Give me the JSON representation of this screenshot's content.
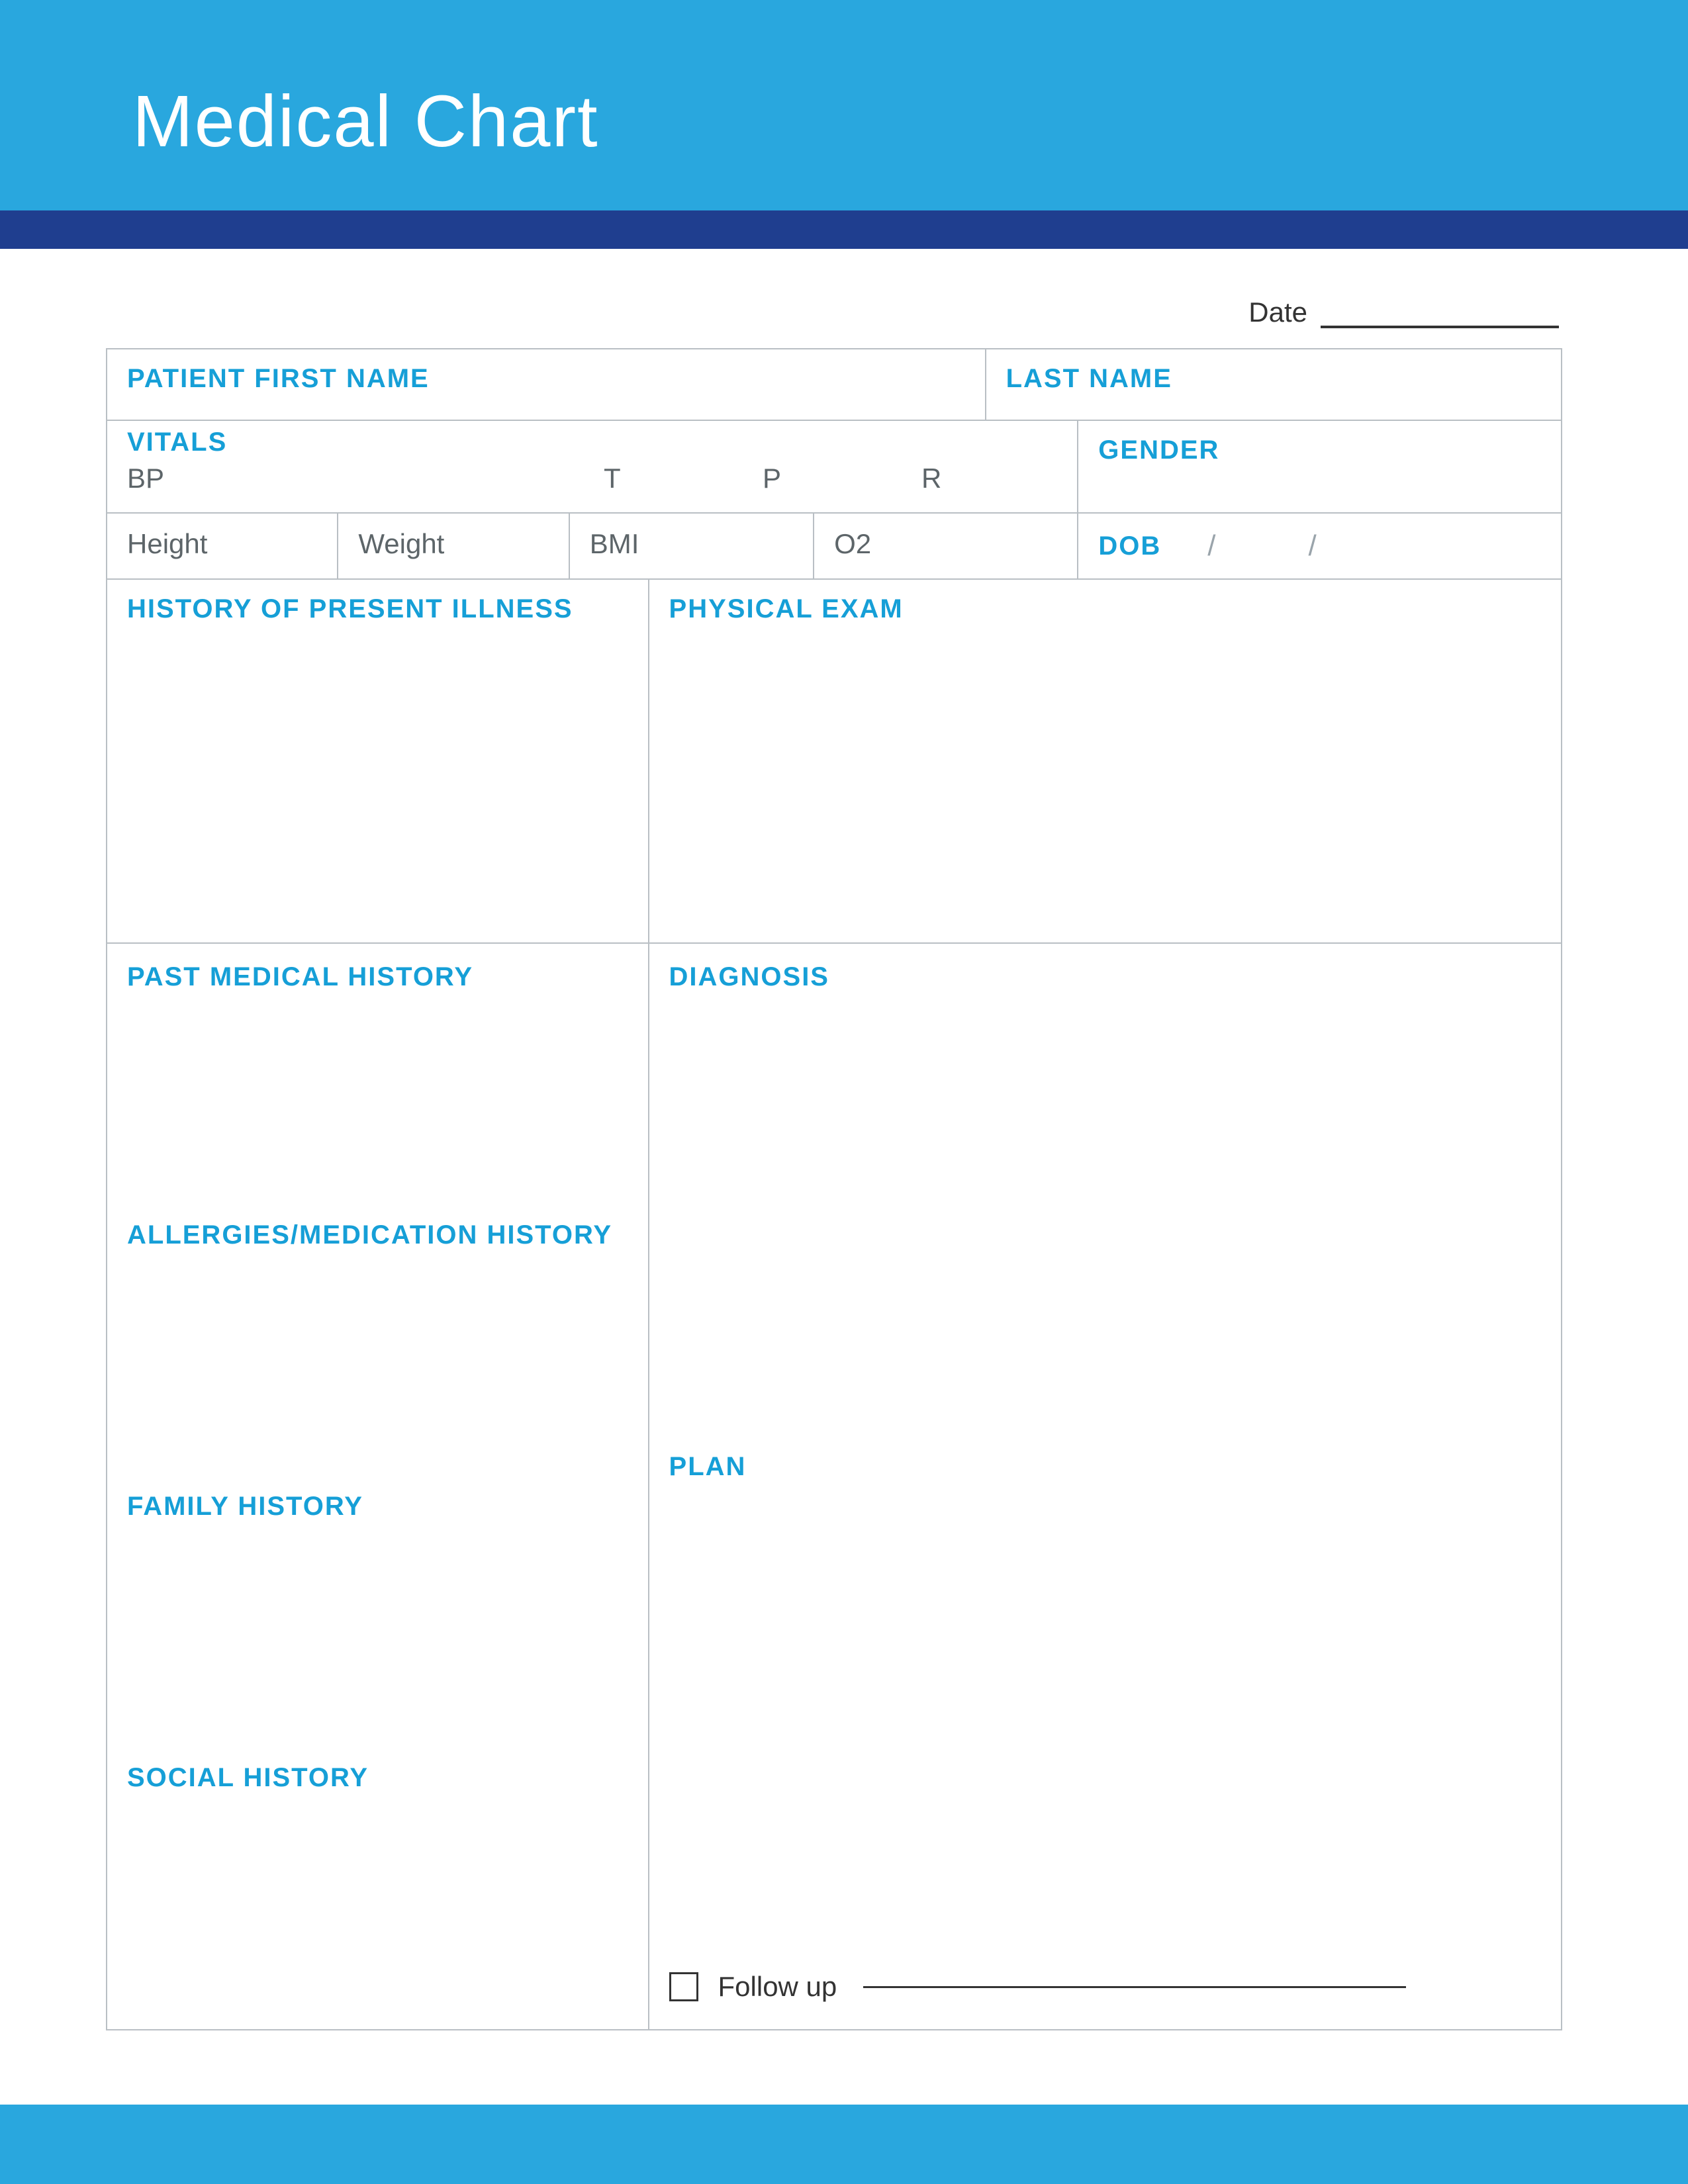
{
  "header": {
    "title": "Medical Chart"
  },
  "date": {
    "label": "Date"
  },
  "patient": {
    "first_name_label": "PATIENT FIRST NAME",
    "last_name_label": "LAST NAME"
  },
  "vitals": {
    "label": "VITALS",
    "bp": "BP",
    "t": "T",
    "p": "P",
    "r": "R"
  },
  "gender": {
    "label": "GENDER"
  },
  "measures": {
    "height": "Height",
    "weight": "Weight",
    "bmi": "BMI",
    "o2": "O2"
  },
  "dob": {
    "label": "DOB"
  },
  "sections": {
    "hpi": "HISTORY OF PRESENT ILLNESS",
    "physical_exam": "PHYSICAL EXAM",
    "past_medical": "PAST MEDICAL HISTORY",
    "diagnosis": "DIAGNOSIS",
    "allergies": "ALLERGIES/MEDICATION HISTORY",
    "plan": "PLAN",
    "family": "FAMILY HISTORY",
    "social": "SOCIAL HISTORY"
  },
  "followup": {
    "label": "Follow up"
  }
}
